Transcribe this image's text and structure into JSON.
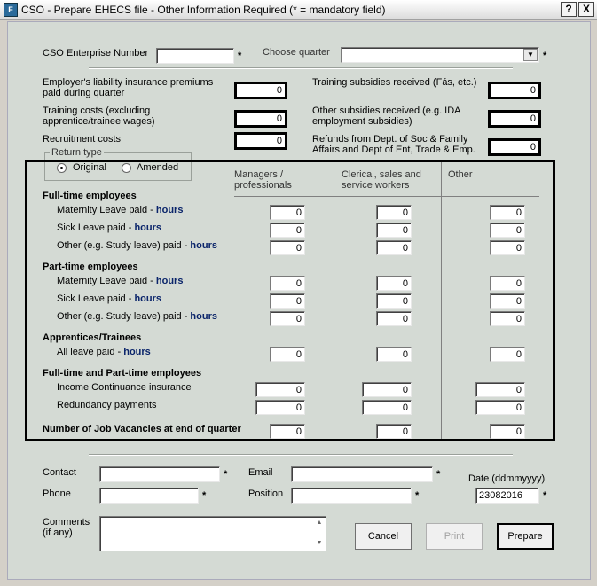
{
  "window": {
    "title": "CSO - Prepare EHECS file - Other Information Required (* = mandatory field)",
    "help_label": "?",
    "close_label": "X"
  },
  "header": {
    "enterprise_number_label": "CSO Enterprise Number",
    "enterprise_number_value": "",
    "choose_quarter_label": "Choose quarter",
    "choose_quarter_value": "",
    "star": "*"
  },
  "costs": {
    "liability_label": "Employer's liability insurance premiums paid during quarter",
    "liability_value": "0",
    "training_costs_label": "Training costs (excluding apprentice/trainee wages)",
    "training_costs_value": "0",
    "recruitment_label": "Recruitment costs",
    "recruitment_value": "0",
    "training_subsidies_label": "Training subsidies received (Fás, etc.)",
    "training_subsidies_value": "0",
    "other_subsidies_label": "Other subsidies received (e.g. IDA employment subsidies)",
    "other_subsidies_value": "0",
    "refunds_label": "Refunds from Dept. of Soc & Family Affairs and Dept of Ent, Trade & Emp.",
    "refunds_value": "0"
  },
  "return_type": {
    "legend": "Return type",
    "original_label": "Original",
    "amended_label": "Amended",
    "selected": "Original"
  },
  "table": {
    "col_managers": "Managers / professionals",
    "col_clerical": "Clerical, sales and service workers",
    "col_other": "Other",
    "hours_word": "hours",
    "fulltime_title": "Full-time employees",
    "parttime_title": "Part-time employees",
    "apprentices_title": "Apprentices/Trainees",
    "ft_pt_title": "Full-time and Part-time employees",
    "maternity_prefix": "Maternity Leave paid - ",
    "sick_prefix": "Sick Leave paid - ",
    "other_leave_prefix": "Other (e.g. Study leave) paid - ",
    "all_leave_prefix": "All leave paid - ",
    "income_label": "Income Continuance insurance",
    "redundancy_label": "Redundancy payments",
    "vacancies_label": "Number of Job Vacancies at end of quarter",
    "values": {
      "ft_maternity": [
        "0",
        "0",
        "0"
      ],
      "ft_sick": [
        "0",
        "0",
        "0"
      ],
      "ft_other": [
        "0",
        "0",
        "0"
      ],
      "pt_maternity": [
        "0",
        "0",
        "0"
      ],
      "pt_sick": [
        "0",
        "0",
        "0"
      ],
      "pt_other": [
        "0",
        "0",
        "0"
      ],
      "app_all": [
        "0",
        "0",
        "0"
      ],
      "income": [
        "0",
        "0",
        "0"
      ],
      "redundancy": [
        "0",
        "0",
        "0"
      ],
      "vacancies": [
        "0",
        "0",
        "0"
      ]
    }
  },
  "contact": {
    "contact_label": "Contact",
    "contact_value": "",
    "email_label": "Email",
    "email_value": "",
    "phone_label": "Phone",
    "phone_value": "",
    "position_label": "Position",
    "position_value": "",
    "date_label": "Date (ddmmyyyy)",
    "date_value": "23082016",
    "comments_label": "Comments (if any)",
    "comments_value": ""
  },
  "buttons": {
    "cancel": "Cancel",
    "print": "Print",
    "prepare": "Prepare"
  },
  "colors": {
    "accent_hours": "#0a246a",
    "background": "#d4dad4"
  }
}
